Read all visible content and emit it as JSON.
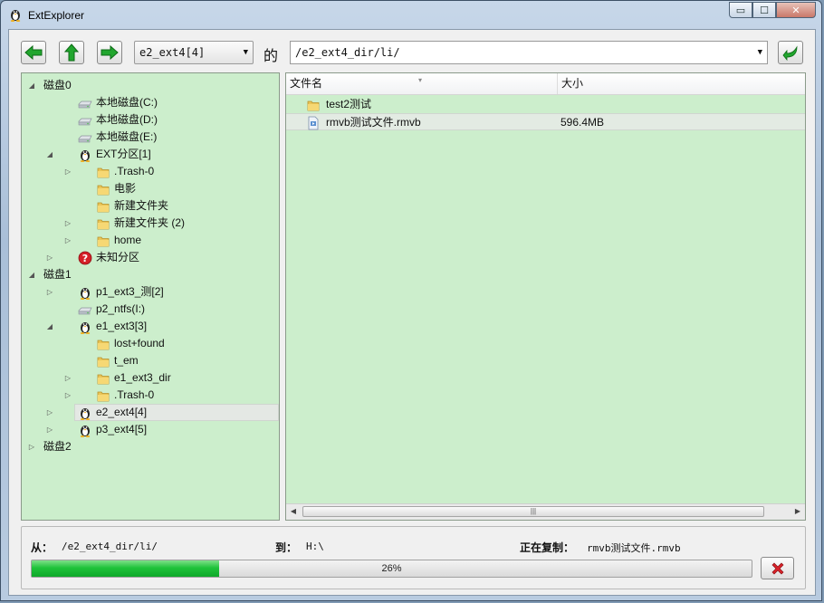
{
  "window": {
    "title": "ExtExplorer",
    "controls": {
      "minimize": "▭",
      "maximize": "☐",
      "close": "✕"
    }
  },
  "toolbar": {
    "back_icon": "green-left-arrow-icon",
    "up_icon": "green-up-arrow-icon",
    "forward_icon": "green-right-arrow-icon",
    "drive_select": "e2_ext4[4]",
    "de_label": "的",
    "path": "/e2_ext4_dir/li/",
    "go_icon": "return-arrow-icon"
  },
  "tree": {
    "items": [
      {
        "label": "磁盘0",
        "level": 0,
        "expander": "expanded",
        "icon": "none"
      },
      {
        "label": "本地磁盘(C:)",
        "level": 1,
        "expander": "none",
        "icon": "drive"
      },
      {
        "label": "本地磁盘(D:)",
        "level": 1,
        "expander": "none",
        "icon": "drive"
      },
      {
        "label": "本地磁盘(E:)",
        "level": 1,
        "expander": "none",
        "icon": "drive"
      },
      {
        "label": "EXT分区[1]",
        "level": 1,
        "expander": "expanded",
        "icon": "penguin"
      },
      {
        "label": ".Trash-0",
        "level": 2,
        "expander": "collapsed",
        "icon": "folder"
      },
      {
        "label": "电影",
        "level": 2,
        "expander": "none",
        "icon": "folder"
      },
      {
        "label": "新建文件夹",
        "level": 2,
        "expander": "none",
        "icon": "folder"
      },
      {
        "label": "新建文件夹 (2)",
        "level": 2,
        "expander": "collapsed",
        "icon": "folder"
      },
      {
        "label": "home",
        "level": 2,
        "expander": "collapsed",
        "icon": "folder"
      },
      {
        "label": "未知分区",
        "level": 1,
        "expander": "collapsed",
        "icon": "unknown"
      },
      {
        "label": "磁盘1",
        "level": 0,
        "expander": "expanded",
        "icon": "none"
      },
      {
        "label": "p1_ext3_测[2]",
        "level": 1,
        "expander": "collapsed",
        "icon": "penguin"
      },
      {
        "label": "p2_ntfs(I:)",
        "level": 1,
        "expander": "none",
        "icon": "drive"
      },
      {
        "label": "e1_ext3[3]",
        "level": 1,
        "expander": "expanded",
        "icon": "penguin"
      },
      {
        "label": "lost+found",
        "level": 2,
        "expander": "none",
        "icon": "folder"
      },
      {
        "label": "t_em",
        "level": 2,
        "expander": "none",
        "icon": "folder"
      },
      {
        "label": "e1_ext3_dir",
        "level": 2,
        "expander": "collapsed",
        "icon": "folder"
      },
      {
        "label": ".Trash-0",
        "level": 2,
        "expander": "collapsed",
        "icon": "folder"
      },
      {
        "label": "e2_ext4[4]",
        "level": 1,
        "expander": "collapsed",
        "icon": "penguin",
        "selected": true
      },
      {
        "label": "p3_ext4[5]",
        "level": 1,
        "expander": "collapsed",
        "icon": "penguin"
      },
      {
        "label": "磁盘2",
        "level": 0,
        "expander": "collapsed",
        "icon": "none"
      }
    ]
  },
  "filelist": {
    "columns": {
      "name": "文件名",
      "size": "大小"
    },
    "rows": [
      {
        "name": "test2测试",
        "size": "",
        "icon": "folder"
      },
      {
        "name": "rmvb测试文件.rmvb",
        "size": "596.4MB",
        "icon": "file",
        "selected": true
      }
    ],
    "scroll_grip": "|||"
  },
  "status": {
    "from_label": "从：",
    "from_value": "/e2_ext4_dir/li/",
    "to_label": "到：",
    "to_value": "H:\\",
    "copying_label": "正在复制：",
    "copying_value": "rmvb测试文件.rmvb",
    "progress": 26,
    "progress_text": "26%",
    "cancel_icon": "red-x-icon"
  },
  "colors": {
    "panel_bg": "#cceecc",
    "progress_green": "#1fc33a",
    "cancel_red": "#d9232a"
  }
}
